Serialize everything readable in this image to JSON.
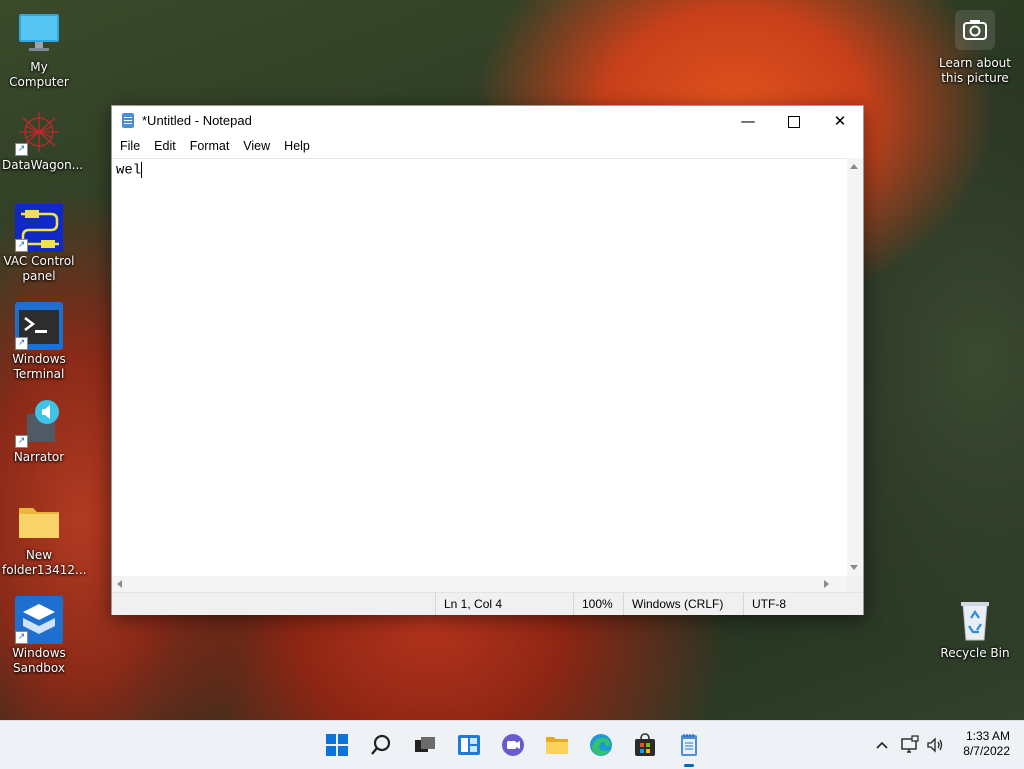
{
  "desktop": {
    "icons_left": [
      {
        "name": "my-computer",
        "label": "My Computer"
      },
      {
        "name": "datawagon",
        "label": "DataWagon..."
      },
      {
        "name": "vac-control-panel",
        "label": "VAC Control panel"
      },
      {
        "name": "windows-terminal",
        "label": "Windows Terminal"
      },
      {
        "name": "narrator",
        "label": "Narrator"
      },
      {
        "name": "new-folder",
        "label": "New folder13412..."
      },
      {
        "name": "windows-sandbox",
        "label": "Windows Sandbox"
      }
    ],
    "learn_about": "Learn about this picture",
    "recycle_bin": "Recycle Bin"
  },
  "notepad": {
    "title": "*Untitled - Notepad",
    "menu": [
      "File",
      "Edit",
      "Format",
      "View",
      "Help"
    ],
    "content": "wel",
    "status": {
      "position": "Ln 1, Col 4",
      "zoom": "100%",
      "line_ending": "Windows (CRLF)",
      "encoding": "UTF-8"
    }
  },
  "taskbar": {
    "time": "1:33 AM",
    "date": "8/7/2022"
  }
}
